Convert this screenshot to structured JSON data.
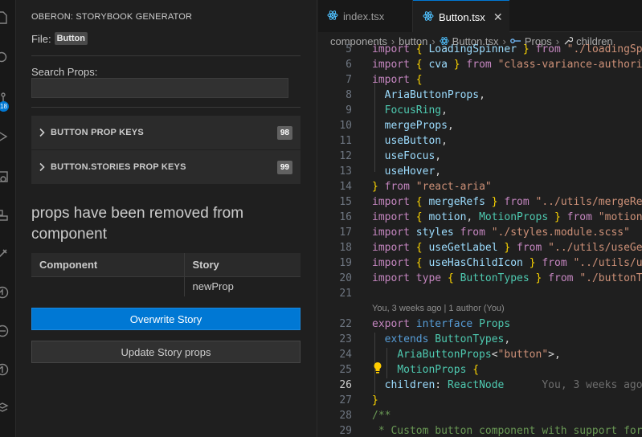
{
  "sidebar": {
    "title": "OBERON: STORYBOOK GENERATOR",
    "file_label": "File:",
    "file_name": "Button",
    "search_label": "Search Props:",
    "search_value": "",
    "sections": [
      {
        "label": "BUTTON PROP KEYS",
        "count": "98"
      },
      {
        "label": "BUTTON.STORIES PROP KEYS",
        "count": "99"
      }
    ],
    "removed_message": " props have been removed from component",
    "table": {
      "headers": [
        "Component",
        "Story"
      ],
      "rows": [
        [
          "",
          "newProp"
        ]
      ]
    },
    "overwrite_button": "Overwrite Story",
    "update_button": "Update Story props"
  },
  "activity_bar": {
    "badge": "18",
    "icons": [
      "explorer-icon",
      "search-icon",
      "source-control-icon",
      "run-debug-icon",
      "extensions-icon",
      "remote-explorer-icon",
      "testing-icon",
      "github-icon",
      "docker-icon",
      "gitlens-icon",
      "storybook-icon"
    ]
  },
  "editor": {
    "tabs": [
      {
        "label": "index.tsx",
        "active": false
      },
      {
        "label": "Button.tsx",
        "active": true
      }
    ],
    "breadcrumb": [
      "components",
      "button",
      "Button.tsx",
      "Props",
      "children"
    ],
    "blame_header": "You, 3 weeks ago | 1 author (You)",
    "inline_blame": "You, 3 weeks ago",
    "current_line": "26"
  },
  "colors": {
    "accent": "#0078d4",
    "keyword": "#c586c0",
    "string": "#ce9178",
    "type": "#4ec9b0",
    "variable": "#9cdcfe"
  }
}
